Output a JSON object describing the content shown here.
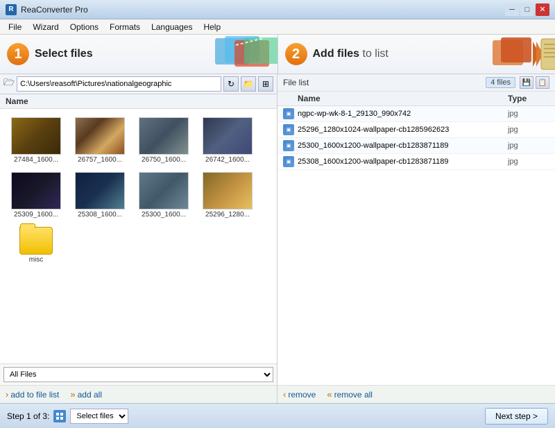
{
  "window": {
    "title": "ReaConverter Pro",
    "min": "─",
    "max": "□",
    "close": "✕"
  },
  "menu": {
    "items": [
      "File",
      "Wizard",
      "Options",
      "Formats",
      "Languages",
      "Help"
    ]
  },
  "step1": {
    "number": "1",
    "label_bold": "Select files",
    "label_rest": ""
  },
  "step2": {
    "number": "2",
    "label_bold": "Add files",
    "label_rest": " to list"
  },
  "path_bar": {
    "path": "C:\\Users\\reasoft\\Pictures\\nationalgeographic",
    "refresh_label": "↻",
    "folder_label": "📁",
    "view_label": "⊞"
  },
  "left_panel": {
    "col_name": "Name"
  },
  "thumbnails": [
    {
      "id": "t1",
      "label": "27484_1600...",
      "color_class": "t1"
    },
    {
      "id": "t2",
      "label": "26757_1600...",
      "color_class": "t2"
    },
    {
      "id": "t3",
      "label": "26750_1600...",
      "color_class": "t3"
    },
    {
      "id": "t4",
      "label": "26742_1600...",
      "color_class": "t4"
    },
    {
      "id": "t5",
      "label": "25309_1600...",
      "color_class": "t5"
    },
    {
      "id": "t6",
      "label": "25308_1600...",
      "color_class": "t6"
    },
    {
      "id": "t7",
      "label": "25300_1600...",
      "color_class": "t7"
    },
    {
      "id": "t8",
      "label": "25296_1280...",
      "color_class": "t8"
    }
  ],
  "folder": {
    "label": "misc"
  },
  "filter": {
    "value": "All Files"
  },
  "actions": {
    "add_label": "add to file list",
    "add_all_label": "add all"
  },
  "right_panel": {
    "header": "File list",
    "file_count": "4 files",
    "col_name": "Name",
    "col_type": "Type",
    "files": [
      {
        "name": "ngpc-wp-wk-8-1_29130_990x742",
        "type": "jpg"
      },
      {
        "name": "25296_1280x1024-wallpaper-cb1285962623",
        "type": "jpg"
      },
      {
        "name": "25300_1600x1200-wallpaper-cb1283871189",
        "type": "jpg"
      },
      {
        "name": "25308_1600x1200-wallpaper-cb1283871189",
        "type": "jpg"
      }
    ]
  },
  "remove_bar": {
    "remove_label": "remove",
    "remove_all_label": "remove all"
  },
  "bottom_bar": {
    "step_label": "Step 1 of 3:",
    "select_files": "Select files",
    "next_label": "Next step >"
  }
}
